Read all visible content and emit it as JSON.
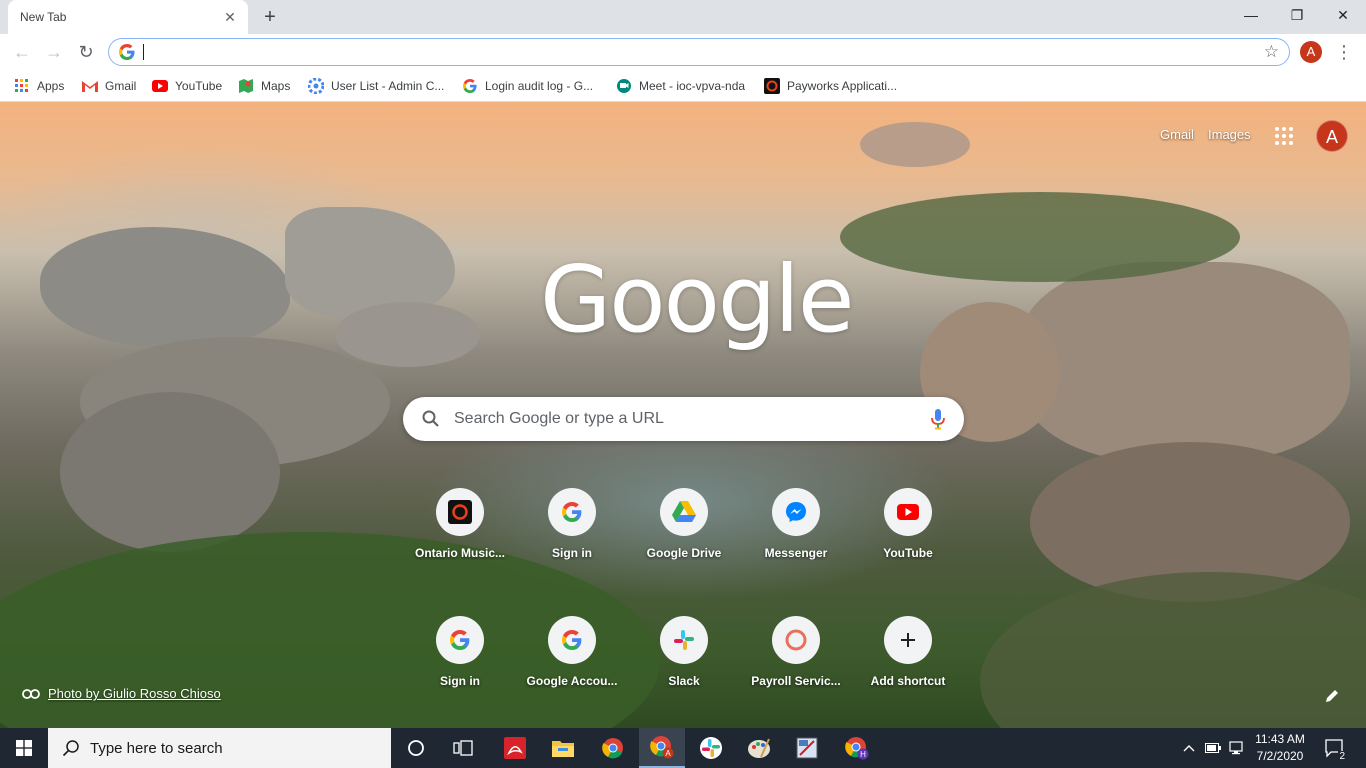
{
  "tab": {
    "title": "New Tab",
    "close": "✕"
  },
  "window_controls": {
    "minimize": "—",
    "restore": "❐",
    "close": "✕"
  },
  "toolbar": {
    "back": "←",
    "forward": "→",
    "reload": "↻",
    "omnibox_value": "",
    "profile_initial": "A"
  },
  "bookmarks": [
    {
      "label": "Apps",
      "icon": "apps-grid-icon",
      "color": "#ea4335"
    },
    {
      "label": "Gmail",
      "icon": "gmail-icon",
      "color": "#ea4335"
    },
    {
      "label": "YouTube",
      "icon": "youtube-icon",
      "color": "#ff0000"
    },
    {
      "label": "Maps",
      "icon": "maps-icon",
      "color": "#34a853"
    },
    {
      "label": "User List - Admin C...",
      "icon": "admin-icon",
      "color": "#4285f4"
    },
    {
      "label": "Login audit log - G...",
      "icon": "google-g-icon",
      "color": "#4285f4"
    },
    {
      "label": "Meet - ioc-vpva-nda",
      "icon": "meet-icon",
      "color": "#00897b"
    },
    {
      "label": "Payworks Applicati...",
      "icon": "payworks-icon",
      "color": "#e8401c"
    }
  ],
  "ntp": {
    "top_links": {
      "gmail": "Gmail",
      "images": "Images"
    },
    "avatar_initial": "A",
    "logo": "Google",
    "search_placeholder": "Search Google or type a URL",
    "shortcuts_row1": [
      {
        "label": "Ontario Music...",
        "icon": "ontario-music-icon"
      },
      {
        "label": "Sign in",
        "icon": "google-g-icon"
      },
      {
        "label": "Google Drive",
        "icon": "google-drive-icon"
      },
      {
        "label": "Messenger",
        "icon": "messenger-icon"
      },
      {
        "label": "YouTube",
        "icon": "youtube-icon"
      }
    ],
    "shortcuts_row2": [
      {
        "label": "Sign in",
        "icon": "google-g-icon"
      },
      {
        "label": "Google Accou...",
        "icon": "google-g-icon"
      },
      {
        "label": "Slack",
        "icon": "slack-icon"
      },
      {
        "label": "Payroll Servic...",
        "icon": "payroll-icon"
      },
      {
        "label": "Add shortcut",
        "icon": "plus-icon"
      }
    ],
    "attribution": "Photo by Giulio Rosso Chioso"
  },
  "taskbar": {
    "search_placeholder": "Type here to search",
    "time": "11:43 AM",
    "date": "7/2/2020",
    "notification_count": "2"
  }
}
